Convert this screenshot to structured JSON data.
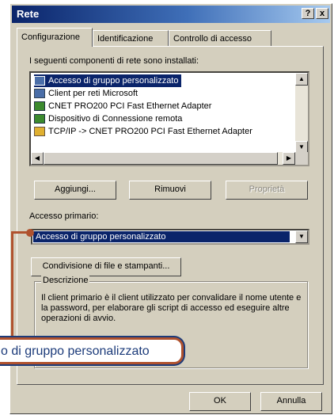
{
  "window": {
    "title": "Rete",
    "help_btn": "?",
    "close_btn": "x"
  },
  "tabs": [
    {
      "label": "Configurazione",
      "active": true
    },
    {
      "label": "Identificazione",
      "active": false
    },
    {
      "label": "Controllo di accesso",
      "active": false
    }
  ],
  "components": {
    "heading": "I seguenti componenti di rete sono installati:",
    "items": [
      {
        "label": "Accesso di gruppo personalizzato",
        "icon": "network-client-icon",
        "selected": true
      },
      {
        "label": "Client per reti Microsoft",
        "icon": "network-client-icon",
        "selected": false
      },
      {
        "label": "CNET PRO200 PCI Fast Ethernet Adapter",
        "icon": "network-adapter-icon",
        "selected": false
      },
      {
        "label": "Dispositivo di Connessione remota",
        "icon": "network-adapter-icon",
        "selected": false
      },
      {
        "label": "TCP/IP -> CNET PRO200 PCI Fast Ethernet Adapter",
        "icon": "protocol-icon",
        "selected": false
      }
    ]
  },
  "buttons": {
    "add": "Aggiungi...",
    "remove": "Rimuovi",
    "properties": "Proprietà"
  },
  "primary_access": {
    "label": "Accesso primario:",
    "value": "Accesso di gruppo personalizzato"
  },
  "sharing_button": "Condivisione di file e stampanti...",
  "description": {
    "label": "Descrizione",
    "text": "Il client primario è il client utilizzato per convalidare il nome utente e la password, per elaborare gli script di accesso ed eseguire altre operazioni di avvio."
  },
  "callout": {
    "text": "o di gruppo personalizzato"
  },
  "footer": {
    "ok": "OK",
    "cancel": "Annulla"
  },
  "colors": {
    "accent": "#b0522e",
    "selection": "#0a246a",
    "dialog": "#d4cfbe"
  }
}
